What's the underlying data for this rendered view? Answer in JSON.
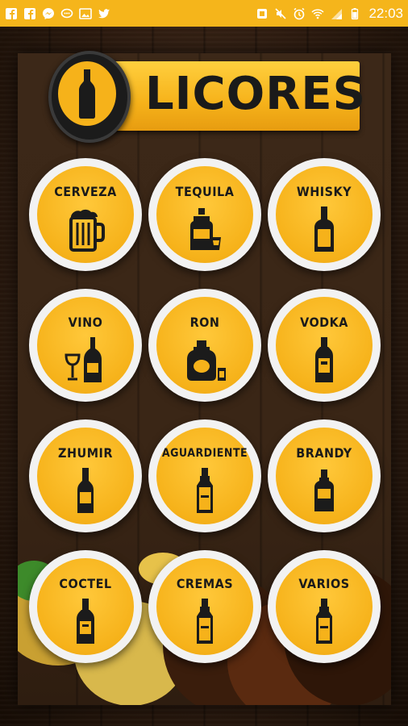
{
  "status_bar": {
    "time": "22:03",
    "left_icons": [
      "facebook-icon",
      "facebook-icon",
      "messenger-icon",
      "chat-icon",
      "image-icon",
      "twitter-icon"
    ],
    "right_icons": [
      "sim-icon",
      "mute-icon",
      "alarm-icon",
      "wifi-icon",
      "signal-icon",
      "battery-icon"
    ],
    "color": "#f5b51b"
  },
  "header": {
    "title": "LICORES",
    "logo_icon": "bottle-icon",
    "accent": "#f6b21a"
  },
  "categories": [
    {
      "label": "CERVEZA",
      "icon": "beer-mug-icon"
    },
    {
      "label": "TEQUILA",
      "icon": "tequila-bottle-icon"
    },
    {
      "label": "WHISKY",
      "icon": "whisky-bottle-icon"
    },
    {
      "label": "VINO",
      "icon": "wine-icon"
    },
    {
      "label": "RON",
      "icon": "rum-bottle-icon"
    },
    {
      "label": "VODKA",
      "icon": "vodka-bottle-icon"
    },
    {
      "label": "ZHUMIR",
      "icon": "zhumir-bottle-icon"
    },
    {
      "label": "AGUARDIENTE",
      "icon": "aguardiente-bottle-icon"
    },
    {
      "label": "BRANDY",
      "icon": "brandy-bottle-icon"
    },
    {
      "label": "COCTEL",
      "icon": "coctel-bottle-icon"
    },
    {
      "label": "CREMAS",
      "icon": "cremas-bottle-icon"
    },
    {
      "label": "VARIOS",
      "icon": "varios-bottle-icon"
    }
  ]
}
